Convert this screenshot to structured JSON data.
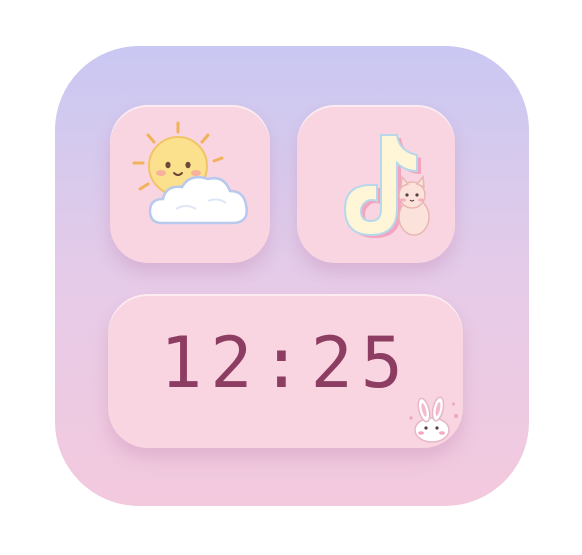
{
  "widget": {
    "clock_time": "12:25"
  },
  "icons": {
    "weather": "sun-cloud-icon",
    "tiktok": "tiktok-icon",
    "bunny": "bunny-sticker-icon",
    "cat": "cat-sticker-icon"
  },
  "colors": {
    "card_top": "#c9c8f2",
    "card_bottom": "#f3c9dd",
    "tile": "#f8d5e0",
    "clock_text": "#8e3d62"
  }
}
